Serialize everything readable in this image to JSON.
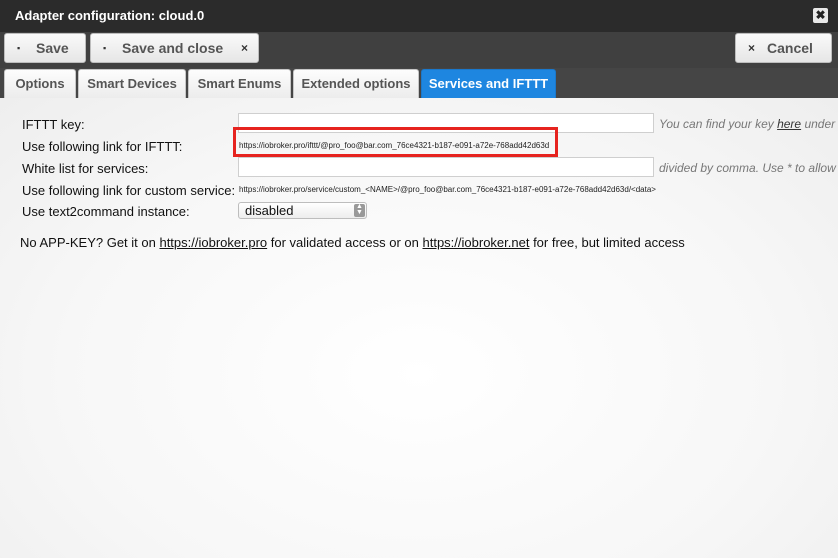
{
  "window": {
    "title": "Adapter configuration: cloud.0",
    "close_icon": "✖"
  },
  "toolbar": {
    "save_label": "Save",
    "save_close_label": "Save and close",
    "cancel_label": "Cancel",
    "save_icon": "▪",
    "x_glyph": "×"
  },
  "tabs": [
    {
      "label": "Options",
      "active": false
    },
    {
      "label": "Smart Devices",
      "active": false
    },
    {
      "label": "Smart Enums",
      "active": false
    },
    {
      "label": "Extended options",
      "active": false
    },
    {
      "label": "Services and IFTTT",
      "active": true
    }
  ],
  "form": {
    "ifttt_key_label": "IFTTT key:",
    "ifttt_key_value": "",
    "ifttt_key_hint_prefix": "You can find your key ",
    "ifttt_key_hint_link": "here",
    "ifttt_key_hint_suffix": " under 'Do",
    "ifttt_link_label": "Use following link for IFTTT:",
    "ifttt_link_value": "https://iobroker.pro/ifttt/@pro_foo@bar.com_76ce4321-b187-e091-a72e-768add42d63d",
    "whitelist_label": "White list for services:",
    "whitelist_value": "",
    "whitelist_hint": "divided by comma. Use * to allow all .",
    "custom_link_label": "Use following link for custom service:",
    "custom_link_value": "https://iobroker.pro/service/custom_<NAME>/@pro_foo@bar.com_76ce4321-b187-e091-a72e-768add42d63d/<data>",
    "text2command_label": "Use text2command instance:",
    "text2command_value": "disabled"
  },
  "note": {
    "part1": "No APP-KEY? Get it on ",
    "link1": "https://iobroker.pro",
    "part2": " for validated access or on ",
    "link2": "https://iobroker.net",
    "part3": " for free, but limited access"
  },
  "colors": {
    "active_tab": "#1e86e0",
    "highlight": "#e6231f",
    "titlebar": "#2b2b2b"
  }
}
